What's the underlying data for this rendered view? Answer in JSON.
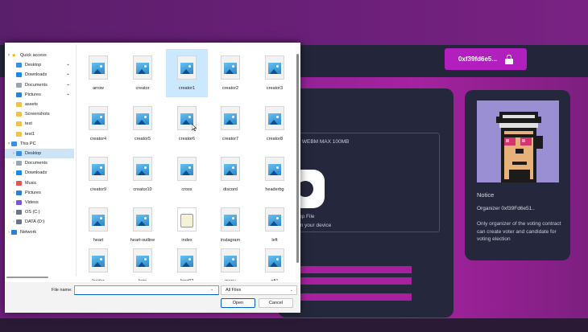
{
  "app": {
    "wallet_address": "0xf39fd6e5...",
    "upload": {
      "hint": "F, WEBM MAX 100MB",
      "drop_title": "op File",
      "drop_subtitle": "on your device"
    },
    "notice": {
      "title": "Notice",
      "organizer": "Organizer 0xf39Fd6e51..",
      "description": "Only organizer of the voting contract can create voter and candidate for voting election"
    },
    "colors": {
      "accent": "#b11fbf",
      "card": "#25283c",
      "avatar_bg": "#9b8fd3"
    }
  },
  "dialog": {
    "nav": [
      {
        "label": "Quick access",
        "icon": "star-icon",
        "chevron": "v"
      },
      {
        "label": "Desktop",
        "icon": "desktop-icon",
        "pinned": true
      },
      {
        "label": "Downloads",
        "icon": "download-icon",
        "pinned": true
      },
      {
        "label": "Documents",
        "icon": "document-icon",
        "pinned": true
      },
      {
        "label": "Pictures",
        "icon": "pictures-icon",
        "pinned": true
      },
      {
        "label": "assets",
        "icon": "folder-icon"
      },
      {
        "label": "Screenshots",
        "icon": "folder-icon"
      },
      {
        "label": "test",
        "icon": "folder-icon"
      },
      {
        "label": "test1",
        "icon": "folder-icon"
      },
      {
        "label": "This PC",
        "icon": "pc-icon",
        "chevron": "v"
      },
      {
        "label": "Desktop",
        "icon": "desktop-icon",
        "chevron": ">",
        "selected": true
      },
      {
        "label": "Documents",
        "icon": "document-icon",
        "chevron": ">"
      },
      {
        "label": "Downloads",
        "icon": "download-icon",
        "chevron": ">"
      },
      {
        "label": "Music",
        "icon": "music-icon",
        "chevron": ">"
      },
      {
        "label": "Pictures",
        "icon": "pictures-icon",
        "chevron": ">"
      },
      {
        "label": "Videos",
        "icon": "videos-icon",
        "chevron": ">"
      },
      {
        "label": "OS (C:)",
        "icon": "drive-icon",
        "chevron": ">"
      },
      {
        "label": "DATA (D:)",
        "icon": "drive-icon",
        "chevron": ">"
      },
      {
        "label": "Network",
        "icon": "network-icon",
        "chevron": ">"
      }
    ],
    "files": [
      {
        "name": "arrow",
        "type": "image"
      },
      {
        "name": "creator",
        "type": "image"
      },
      {
        "name": "creator1",
        "type": "image",
        "selected": true
      },
      {
        "name": "creator2",
        "type": "image"
      },
      {
        "name": "creator3",
        "type": "image"
      },
      {
        "name": "creator4",
        "type": "image"
      },
      {
        "name": "creator5",
        "type": "image"
      },
      {
        "name": "creator6",
        "type": "image"
      },
      {
        "name": "creator7",
        "type": "image"
      },
      {
        "name": "creator8",
        "type": "image"
      },
      {
        "name": "creator9",
        "type": "image"
      },
      {
        "name": "creator10",
        "type": "image"
      },
      {
        "name": "cross",
        "type": "image"
      },
      {
        "name": "discord",
        "type": "image"
      },
      {
        "name": "headerbg",
        "type": "image"
      },
      {
        "name": "heart",
        "type": "image"
      },
      {
        "name": "heart-outline",
        "type": "image"
      },
      {
        "name": "index",
        "type": "html"
      },
      {
        "name": "instagram",
        "type": "image"
      },
      {
        "name": "left",
        "type": "image"
      },
      {
        "name": "loader",
        "type": "image"
      },
      {
        "name": "logo",
        "type": "image"
      },
      {
        "name": "logo02",
        "type": "image"
      },
      {
        "name": "menu",
        "type": "image"
      },
      {
        "name": "nft1",
        "type": "image"
      }
    ],
    "file_name_label": "File name:",
    "file_name_value": "",
    "filter_label": "All Files",
    "open_label": "Open",
    "cancel_label": "Cancel"
  }
}
